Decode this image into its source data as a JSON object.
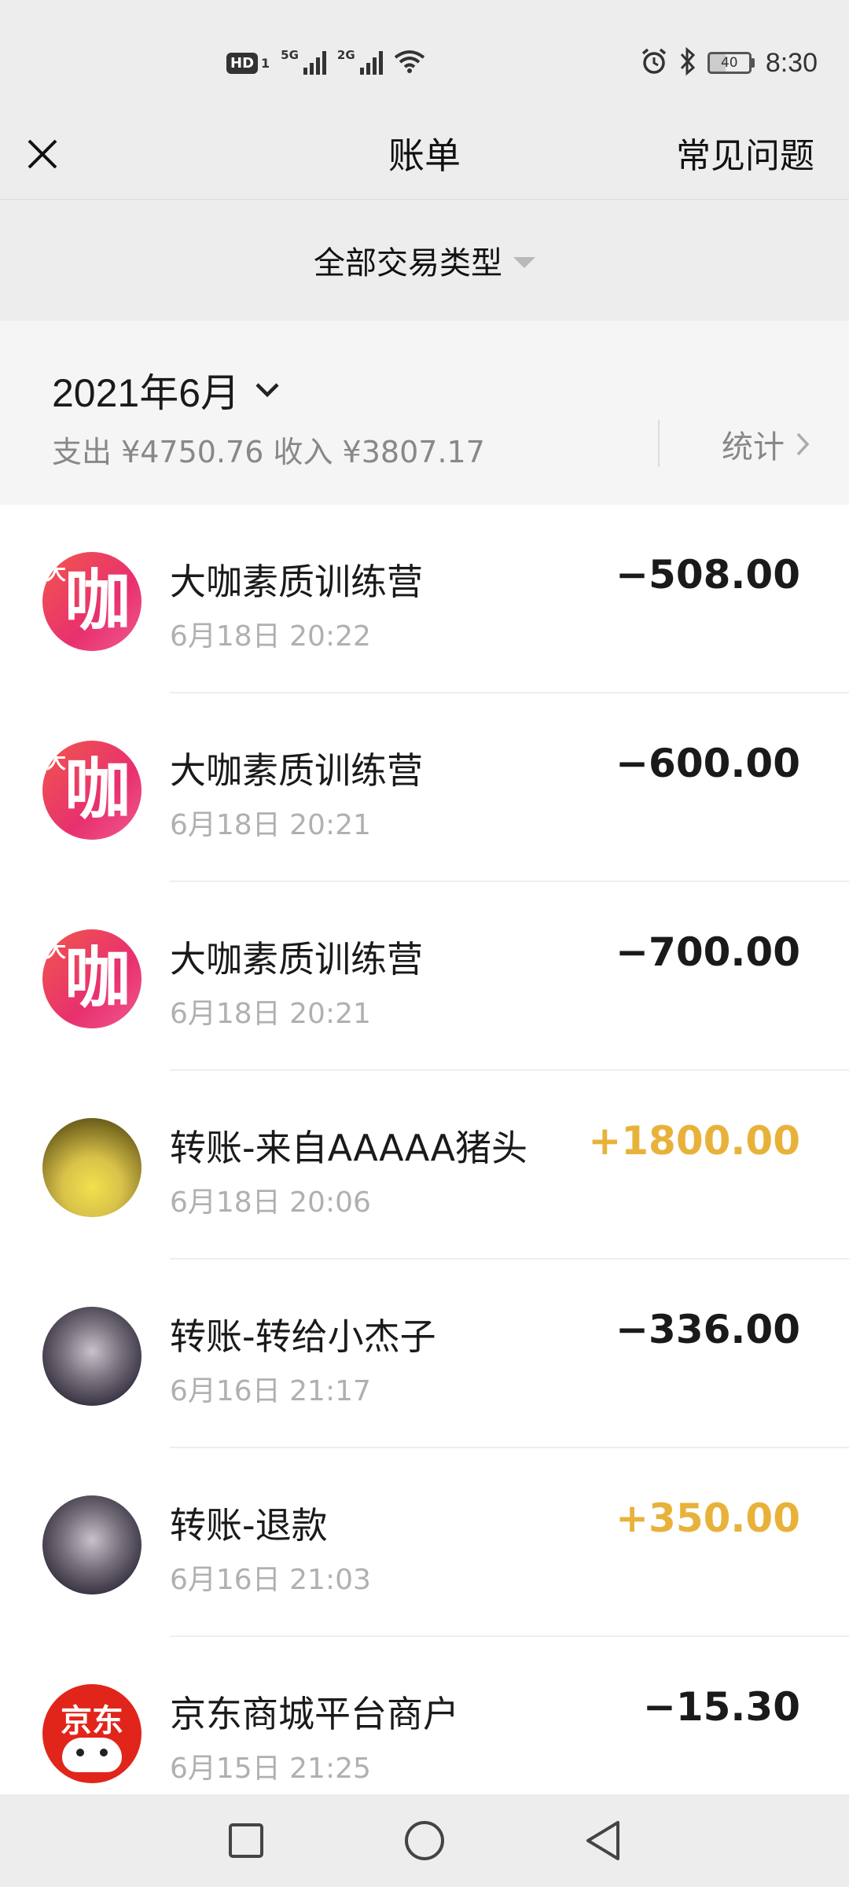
{
  "status_bar": {
    "hd": "HD",
    "sim": "1",
    "net1": "5G",
    "net2": "2G",
    "battery": "40",
    "time": "8:30"
  },
  "header": {
    "title": "账单",
    "faq": "常见问题"
  },
  "filter": {
    "label": "全部交易类型"
  },
  "summary": {
    "month": "2021年6月",
    "totals": "支出 ¥4750.76 收入 ¥3807.17",
    "stats": "统计"
  },
  "transactions": [
    {
      "name": "大咖素质训练营",
      "time": "6月18日 20:22",
      "amount": "−508.00",
      "type": "expense"
    },
    {
      "name": "大咖素质训练营",
      "time": "6月18日 20:21",
      "amount": "−600.00",
      "type": "expense"
    },
    {
      "name": "大咖素质训练营",
      "time": "6月18日 20:21",
      "amount": "−700.00",
      "type": "expense"
    },
    {
      "name": "转账-来自AAAAA猪头",
      "time": "6月18日 20:06",
      "amount": "+1800.00",
      "type": "income"
    },
    {
      "name": "转账-转给小杰子",
      "time": "6月16日 21:17",
      "amount": "−336.00",
      "type": "expense"
    },
    {
      "name": "转账-退款",
      "time": "6月16日 21:03",
      "amount": "+350.00",
      "type": "income"
    },
    {
      "name": "京东商城平台商户",
      "time": "6月15日 21:25",
      "amount": "−15.30",
      "type": "expense"
    }
  ],
  "avatars": {
    "daka_big": "咖",
    "daka_small": "大",
    "jd_text": "京东"
  },
  "colors": {
    "income": "#e8b23a",
    "expense": "#1a1a1a",
    "background": "#ededed"
  },
  "icons": {
    "close": "close-icon",
    "dropdown": "triangle-down-icon",
    "month_chevron": "chevron-down-icon",
    "stats_chevron": "chevron-right-icon",
    "nav": [
      "square-icon",
      "circle-icon",
      "back-triangle-icon"
    ]
  }
}
